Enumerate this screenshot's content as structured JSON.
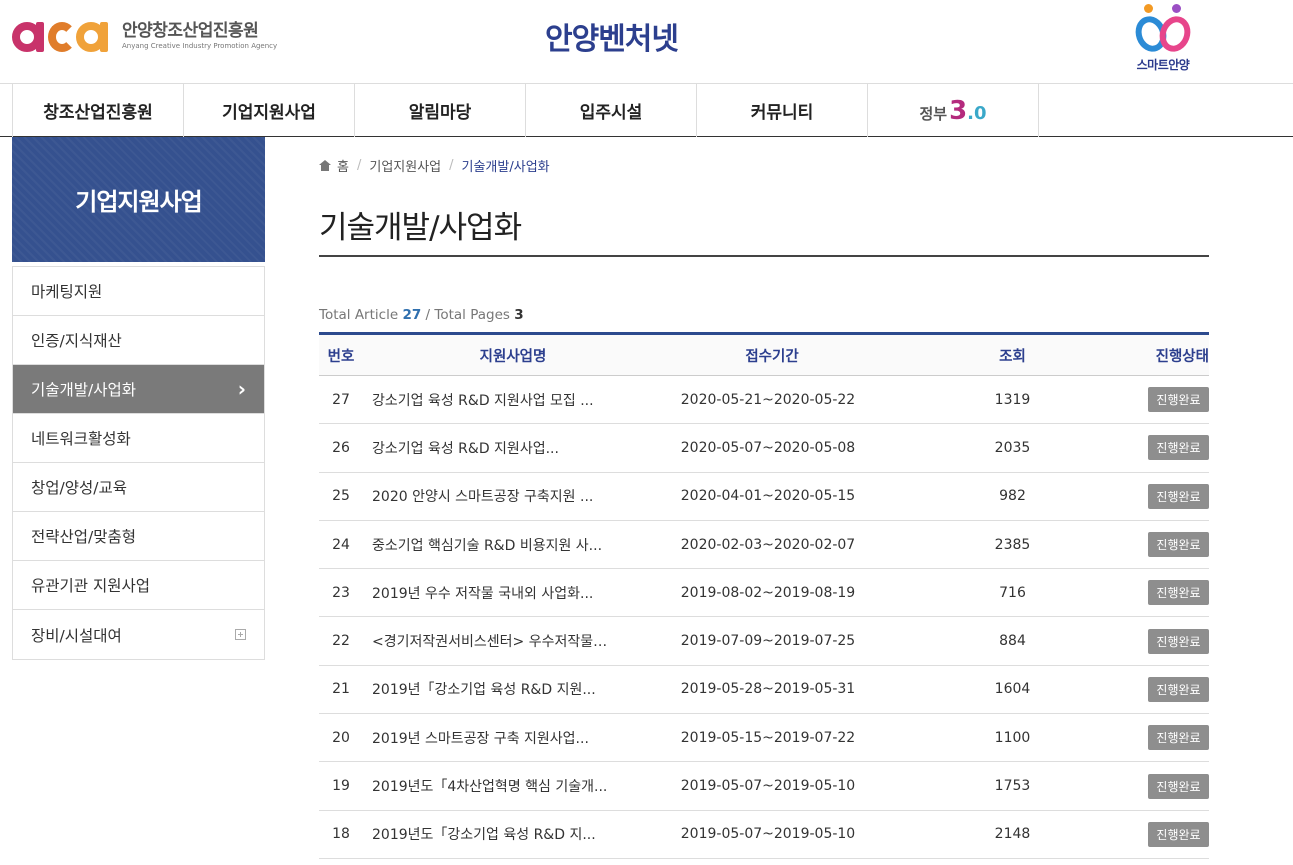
{
  "header": {
    "logo_text": "안양창조산업진흥원",
    "logo_sub": "Anyang Creative Industry Promotion Agency",
    "site_title": "안양벤처넷",
    "smart_label": "스마트안양"
  },
  "gnb": {
    "items": [
      "창조산업진흥원",
      "기업지원사업",
      "알림마당",
      "입주시설",
      "커뮤니티"
    ],
    "gov_label": "정부",
    "gov_big": "3",
    "gov_small": ".0"
  },
  "lnb": {
    "title": "기업지원사업",
    "items": [
      "마케팅지원",
      "인증/지식재산",
      "기술개발/사업화",
      "네트워크활성화",
      "창업/양성/교육",
      "전략산업/맞춤형",
      "유관기관 지원사업",
      "장비/시설대여"
    ],
    "active_index": 2
  },
  "breadcrumb": {
    "home": "홈",
    "level1": "기업지원사업",
    "current": "기술개발/사업화",
    "sep": "/"
  },
  "page_title": "기술개발/사업화",
  "summary": {
    "article_label": "Total Article",
    "article_count": "27",
    "pages_label": "/ Total Pages",
    "pages_count": "3"
  },
  "board": {
    "columns": [
      "번호",
      "지원사업명",
      "접수기간",
      "조회",
      "진행상태"
    ],
    "rows": [
      {
        "no": "27",
        "title": "강소기업 육성 R&D 지원사업 모집 ...",
        "period": "2020-05-21~2020-05-22",
        "hits": "1319",
        "status": "진행완료"
      },
      {
        "no": "26",
        "title": "강소기업 육성 R&D 지원사업...",
        "period": "2020-05-07~2020-05-08",
        "hits": "2035",
        "status": "진행완료"
      },
      {
        "no": "25",
        "title": "2020 안양시 스마트공장 구축지원 ...",
        "period": "2020-04-01~2020-05-15",
        "hits": "982",
        "status": "진행완료"
      },
      {
        "no": "24",
        "title": "중소기업 핵심기술 R&D 비용지원 사...",
        "period": "2020-02-03~2020-02-07",
        "hits": "2385",
        "status": "진행완료"
      },
      {
        "no": "23",
        "title": "2019년 우수 저작물 국내외 사업화...",
        "period": "2019-08-02~2019-08-19",
        "hits": "716",
        "status": "진행완료"
      },
      {
        "no": "22",
        "title": "<경기저작권서비스센터> 우수저작물…",
        "period": "2019-07-09~2019-07-25",
        "hits": "884",
        "status": "진행완료"
      },
      {
        "no": "21",
        "title": "2019년「강소기업 육성 R&D 지원...",
        "period": "2019-05-28~2019-05-31",
        "hits": "1604",
        "status": "진행완료"
      },
      {
        "no": "20",
        "title": "2019년 스마트공장 구축 지원사업...",
        "period": "2019-05-15~2019-07-22",
        "hits": "1100",
        "status": "진행완료"
      },
      {
        "no": "19",
        "title": "2019년도「4차산업혁명 핵심 기술개...",
        "period": "2019-05-07~2019-05-10",
        "hits": "1753",
        "status": "진행완료"
      },
      {
        "no": "18",
        "title": "2019년도「강소기업 육성 R&D 지...",
        "period": "2019-05-07~2019-05-10",
        "hits": "2148",
        "status": "진행완료"
      }
    ]
  }
}
